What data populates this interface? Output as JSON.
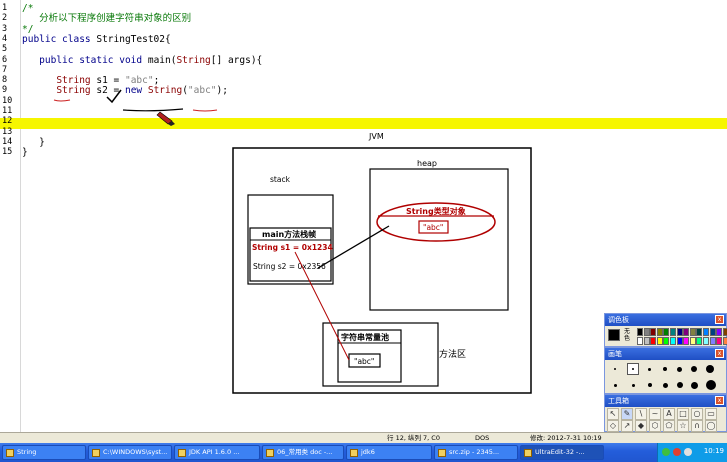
{
  "code_lines": [
    {
      "n": "1",
      "parts": [
        {
          "c": "cm",
          "t": "/*"
        }
      ]
    },
    {
      "n": "2",
      "parts": [
        {
          "c": "cm",
          "t": "   分析以下程序创建字符串对象的区别"
        }
      ]
    },
    {
      "n": "3",
      "parts": [
        {
          "c": "cm",
          "t": "*/"
        }
      ]
    },
    {
      "n": "4",
      "parts": [
        {
          "c": "kw",
          "t": "public class "
        },
        {
          "c": "pl",
          "t": "StringTest02{"
        }
      ]
    },
    {
      "n": "5",
      "parts": []
    },
    {
      "n": "6",
      "parts": [
        {
          "c": "kw",
          "t": "   public static void "
        },
        {
          "c": "pl",
          "t": "main("
        },
        {
          "c": "rd",
          "t": "String"
        },
        {
          "c": "pl",
          "t": "[] args){"
        }
      ]
    },
    {
      "n": "7",
      "parts": []
    },
    {
      "n": "8",
      "parts": [
        {
          "c": "rd",
          "t": "      String "
        },
        {
          "c": "pl",
          "t": "s1 = "
        },
        {
          "c": "st",
          "t": "\"abc\""
        },
        {
          "c": "pl",
          "t": ";"
        }
      ]
    },
    {
      "n": "9",
      "parts": [
        {
          "c": "rd",
          "t": "      String "
        },
        {
          "c": "pl",
          "t": "s2 = "
        },
        {
          "c": "kw",
          "t": "new "
        },
        {
          "c": "rd",
          "t": "String"
        },
        {
          "c": "pl",
          "t": "("
        },
        {
          "c": "st",
          "t": "\"abc\""
        },
        {
          "c": "pl",
          "t": ");"
        }
      ]
    },
    {
      "n": "10",
      "parts": []
    },
    {
      "n": "11",
      "parts": []
    },
    {
      "n": "12",
      "parts": []
    },
    {
      "n": "13",
      "parts": []
    },
    {
      "n": "14",
      "parts": [
        {
          "c": "pl",
          "t": "   }"
        }
      ]
    },
    {
      "n": "15",
      "parts": [
        {
          "c": "pl",
          "t": "}"
        }
      ]
    }
  ],
  "diagram": {
    "jvm": "JVM",
    "heap": "heap",
    "stack": "stack",
    "string_object": "String类型对象",
    "abc_heap": "\"abc\"",
    "frame_title": "main方法栈帧",
    "s1_ref": "String s1 = 0x1234",
    "s2_ref": "String s2 = 0x2356",
    "pool_title": "字符串常量池",
    "abc_pool": "\"abc\"",
    "method_area": "方法区",
    "red": "#b00000"
  },
  "palettes": {
    "colors_title": "调色板",
    "colors_side": "无色",
    "brush_title": "画笔",
    "tools_title": "工具箱",
    "swatches": [
      "#000000",
      "#808080",
      "#800000",
      "#808000",
      "#008000",
      "#008080",
      "#000080",
      "#800080",
      "#808040",
      "#004040",
      "#0080ff",
      "#004080",
      "#8000ff",
      "#804000",
      "#ffffff",
      "#c0c0c0",
      "#ff0000",
      "#ffff00",
      "#00ff00",
      "#00ffff",
      "#0000ff",
      "#ff00ff",
      "#ffff80",
      "#00ff80",
      "#80ffff",
      "#8080ff",
      "#ff0080",
      "#ff8040"
    ]
  },
  "status": {
    "position": "行 12, 纵列 7, C0",
    "format": "DOS",
    "modified": "修改:  2012-7-31 10:19"
  },
  "taskbar": {
    "buttons": [
      "String",
      "C:\\WINDOWS\\syst...",
      "JDK API 1.6.0 ...",
      "06_常用类 doc -...",
      "jdk6",
      "src.zip - 2345...",
      "UltraEdit-32 -..."
    ],
    "clock": "10:19"
  }
}
